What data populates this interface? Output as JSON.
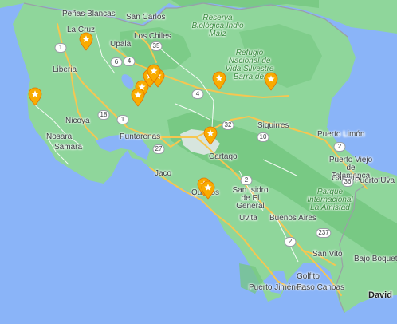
{
  "map": {
    "colors": {
      "sea": "#8ab4f8",
      "land": "#8fd69b",
      "forest": "#74c780",
      "road_major": "#f6c651",
      "road_minor": "#ffffff",
      "border": "#9aa0a6",
      "marker": "#f9ab00",
      "urban": "#e8eaed"
    },
    "places": [
      {
        "name": "Peñas Blancas"
      },
      {
        "name": "San Carlos"
      },
      {
        "name": "La Cruz"
      },
      {
        "name": "Upala"
      },
      {
        "name": "Los Chiles"
      },
      {
        "name": "Liberia"
      },
      {
        "name": "Nicoya"
      },
      {
        "name": "Nosara"
      },
      {
        "name": "Samara"
      },
      {
        "name": "Puntarenas"
      },
      {
        "name": "Jaco"
      },
      {
        "name": "Cartago"
      },
      {
        "name": "Siquirres"
      },
      {
        "name": "Puerto Limón"
      },
      {
        "name": "Puerto Viejo de Talamanca"
      },
      {
        "name": "Cahuita"
      },
      {
        "name": "Puerto Uva"
      },
      {
        "name": "Quepos"
      },
      {
        "name": "San Isidro de El General"
      },
      {
        "name": "Buenos Aires"
      },
      {
        "name": "Uvita"
      },
      {
        "name": "San Vito"
      },
      {
        "name": "Golfito"
      },
      {
        "name": "Puerto Jiménez"
      },
      {
        "name": "Paso Canoas"
      },
      {
        "name": "Bajo Boquete"
      },
      {
        "name": "David"
      }
    ],
    "reserves": [
      {
        "name": "Reserva Biológica Indio Maíz"
      },
      {
        "name": "Refugio Nacional de Vida Silvestre Barra del"
      },
      {
        "name": "Parque Internacional La Amistad"
      }
    ],
    "route_shields": [
      {
        "label": "1",
        "kind": "national"
      },
      {
        "label": "6",
        "kind": "national"
      },
      {
        "label": "4",
        "kind": "national"
      },
      {
        "label": "35",
        "kind": "national"
      },
      {
        "label": "4",
        "kind": "national"
      },
      {
        "label": "18",
        "kind": "national"
      },
      {
        "label": "1",
        "kind": "national"
      },
      {
        "label": "27",
        "kind": "national"
      },
      {
        "label": "32",
        "kind": "national"
      },
      {
        "label": "10",
        "kind": "national"
      },
      {
        "label": "2",
        "kind": "national"
      },
      {
        "label": "2",
        "kind": "national"
      },
      {
        "label": "2",
        "kind": "national"
      },
      {
        "label": "36",
        "kind": "national"
      },
      {
        "label": "237",
        "kind": "national"
      }
    ],
    "markers": [
      {
        "icon": "star-icon"
      },
      {
        "icon": "star-icon"
      },
      {
        "icon": "star-icon"
      },
      {
        "icon": "star-icon"
      },
      {
        "icon": "star-icon"
      },
      {
        "icon": "star-icon"
      },
      {
        "icon": "star-icon"
      },
      {
        "icon": "star-icon"
      },
      {
        "icon": "star-icon"
      },
      {
        "icon": "star-icon"
      },
      {
        "icon": "star-icon"
      },
      {
        "icon": "star-icon"
      }
    ]
  }
}
